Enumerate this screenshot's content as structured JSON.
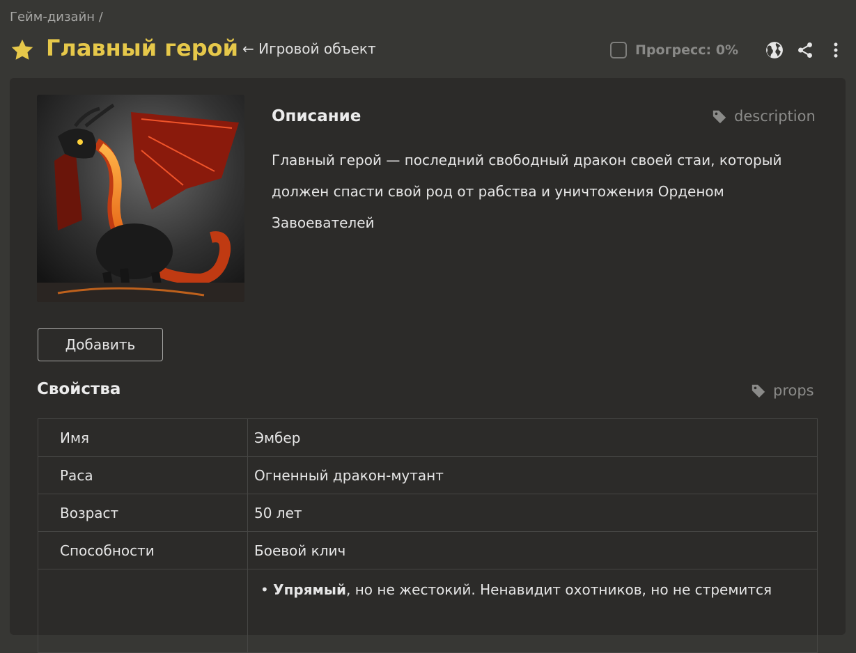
{
  "breadcrumb": "Гейм-дизайн /",
  "header": {
    "title": "Главный герой",
    "back_link": "← Игровой объект",
    "progress_label": "Прогресс: 0%",
    "title_color": "#e6c84a",
    "icons": [
      "star-icon",
      "globe-icon",
      "share-icon",
      "more-vertical-icon"
    ]
  },
  "description": {
    "heading": "Описание",
    "tag": "description",
    "text": "Главный герой — последний свободный дракон своей стаи, который должен спасти свой род от рабства и уничтожения Орденом Завоевателей"
  },
  "image": {
    "subject": "red-dragon-illustration"
  },
  "add_button": "Добавить",
  "properties": {
    "heading": "Свойства",
    "tag": "props",
    "rows": [
      {
        "key": "Имя",
        "value": "Эмбер"
      },
      {
        "key": "Раса",
        "value": "Огненный дракон-мутант"
      },
      {
        "key": "Возраст",
        "value": "50 лет"
      },
      {
        "key": "Способности",
        "value": "Боевой клич"
      }
    ],
    "trait": {
      "bold": "Упрямый",
      "rest": ", но не жестокий. Ненавидит охотников, но не стремится"
    }
  }
}
